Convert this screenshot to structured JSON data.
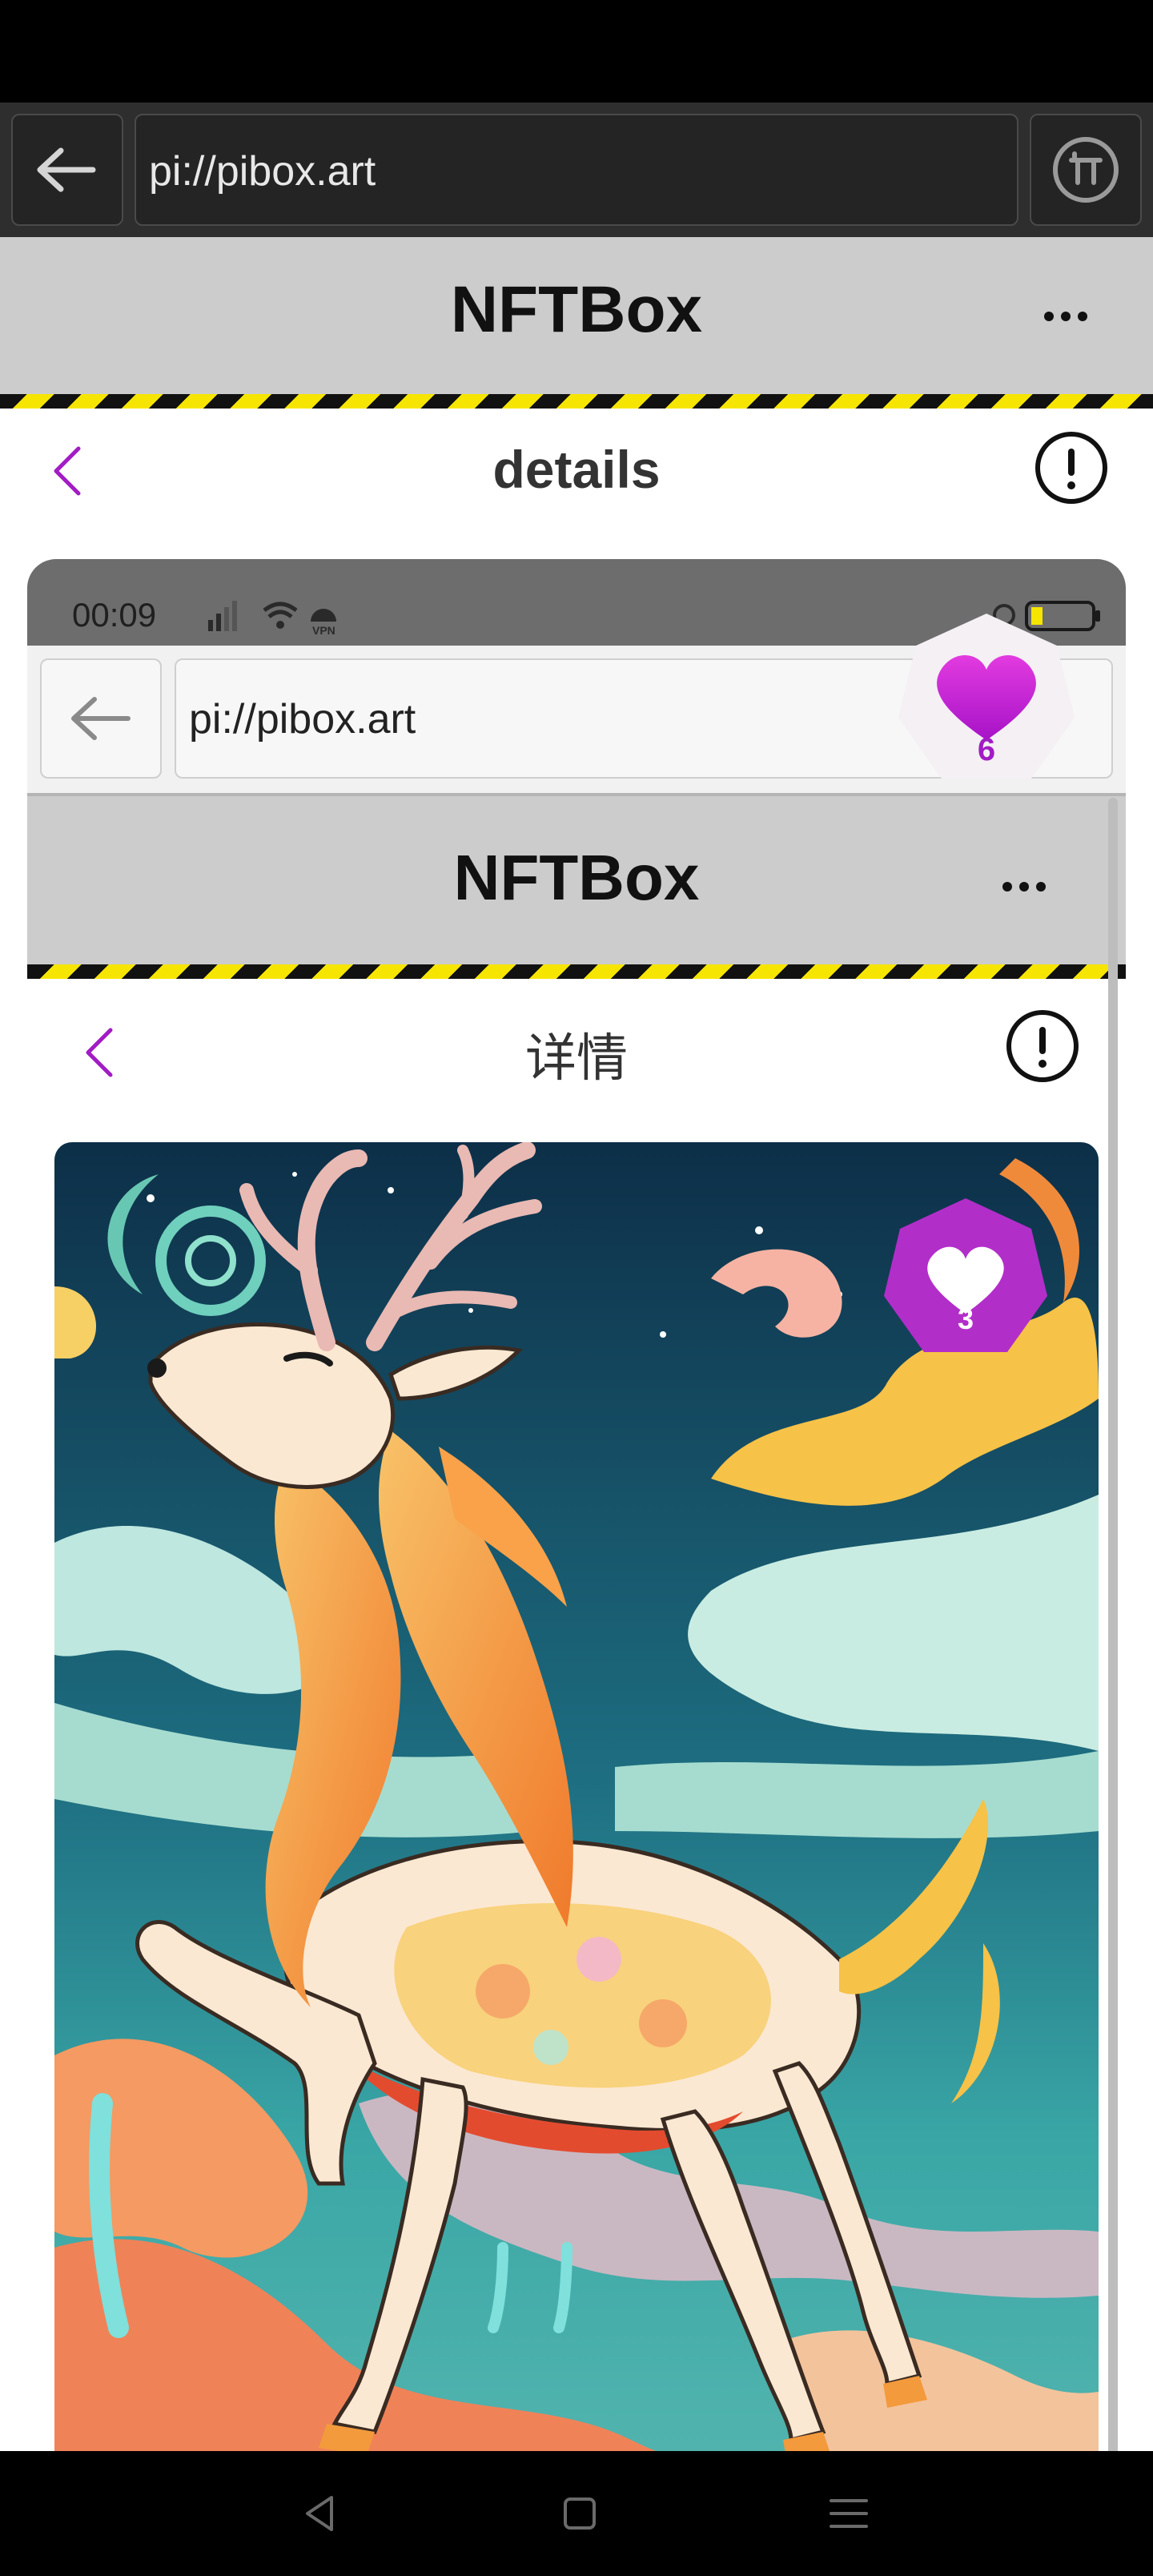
{
  "outer_browser": {
    "url": "pi://pibox.art"
  },
  "outer_header": {
    "title": "NFTBox"
  },
  "outer_details": {
    "title": "details"
  },
  "floating_like": {
    "count": "6"
  },
  "inner": {
    "status_time": "00:09",
    "vpn_label": "VPN",
    "url": "pi://pibox.art",
    "header_title": "NFTBox",
    "details_title": "详情",
    "like_count": "3"
  },
  "colors": {
    "accent": "#a21cc4",
    "header_bg": "#cccccc",
    "hazard_yellow": "#f6e500"
  },
  "icons": [
    "back-arrow-icon",
    "pi-logo-icon",
    "more-icon",
    "chevron-left-icon",
    "info-icon",
    "heart-icon",
    "signal-icon",
    "wifi-icon",
    "vpn-icon",
    "battery-icon",
    "nav-back-icon",
    "nav-home-icon",
    "nav-menu-icon"
  ]
}
